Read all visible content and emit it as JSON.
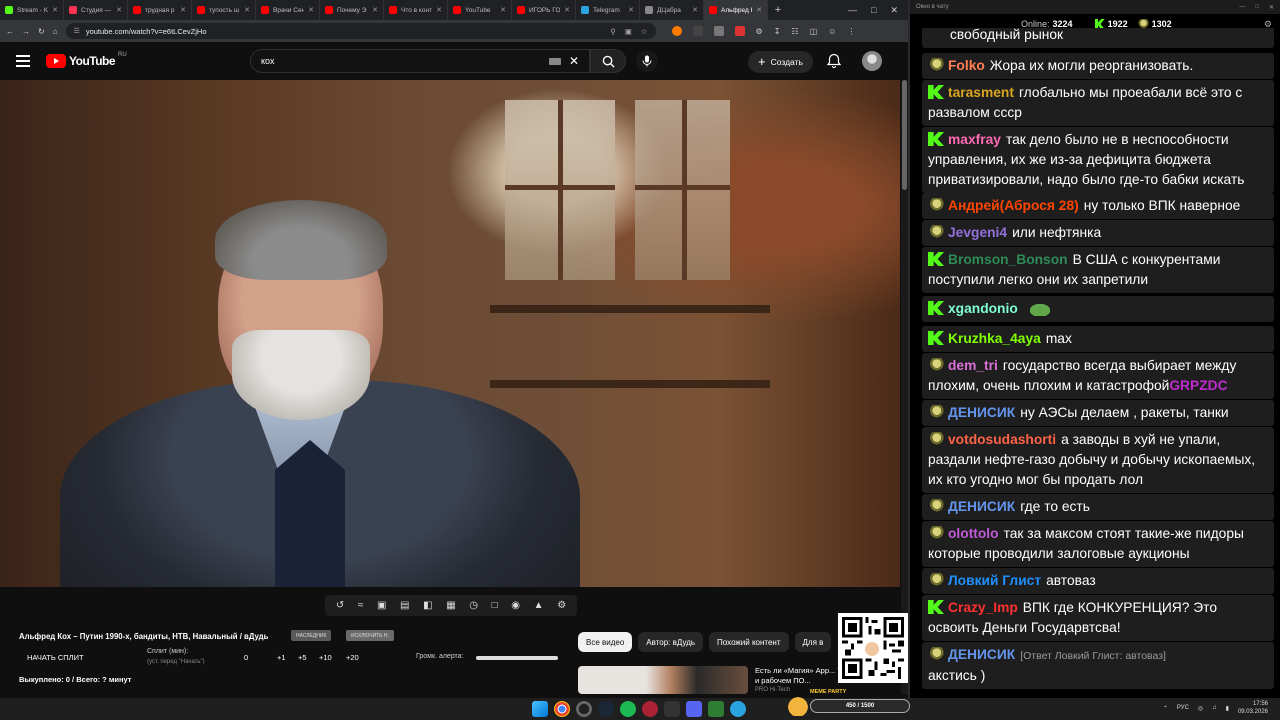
{
  "browser": {
    "tabs": [
      {
        "title": "Stream - K",
        "color": "#53fc18",
        "active": false
      },
      {
        "title": "Студия —",
        "color": "#ff3355",
        "active": false
      },
      {
        "title": "трудная р",
        "color": "#ff0000",
        "active": false
      },
      {
        "title": "тупость ш",
        "color": "#ff0000",
        "active": false
      },
      {
        "title": "Врачи Сен",
        "color": "#ff0000",
        "active": false
      },
      {
        "title": "Почему Э",
        "color": "#ff0000",
        "active": false
      },
      {
        "title": "Что в конт",
        "color": "#ff0000",
        "active": false
      },
      {
        "title": "YouTube",
        "color": "#ff0000",
        "active": false
      },
      {
        "title": "ИГОРЬ ГО",
        "color": "#ff0000",
        "active": false
      },
      {
        "title": "Telegram",
        "color": "#2aa3df",
        "active": false
      },
      {
        "title": "ДЦабра",
        "color": "#888888",
        "active": false
      },
      {
        "title": "Альфред К",
        "color": "#ff0000",
        "active": true
      }
    ],
    "url": "youtube.com/watch?v=e6tLCevZjHo"
  },
  "youtube": {
    "logo_text": "YouTube",
    "region": "RU",
    "search_value": "кох",
    "create_label": "Создать"
  },
  "video": {
    "title": "Альфред Кох – Путин 1990-х, бандиты, НТВ, Навальный / вДудь",
    "badge_1": "НАСЛЕДНИК",
    "badge_2": "ИСКЛЮЧИТЬ Н.",
    "split_start": "НАЧАТЬ СПЛИТ",
    "split_label": "Сплит (мин):",
    "split_hint": "(уст. перед \"Начать\")",
    "steps": [
      "0",
      "+1",
      "+5",
      "+10",
      "+20"
    ],
    "alert_label": "Громк. алерта:",
    "alert_volume": 1.0,
    "bought_line": "Выкуплено: 0 / Всего: ? минут"
  },
  "chips": [
    "Все видео",
    "Автор: вДудь",
    "Похожий контент",
    "Для в"
  ],
  "related": {
    "title": "Есть ли «Магия» App... Тест в играх и рабочем ПО...",
    "channel": "PRO Hi-Tech"
  },
  "chat": {
    "window_title": "Окно в чату",
    "online_label": "Online:",
    "online_count": "3224",
    "kick_count": "1922",
    "twitch_count": "1302",
    "top_partial": "свободный рынок",
    "messages": [
      {
        "badge": "bulb",
        "nick": "Folko",
        "color": "#ff7f50",
        "text": "Жора их могли реорганизовать."
      },
      {
        "badge": "kick",
        "nick": "tarasment",
        "color": "#daa520",
        "text": "глобально мы проеабали всё это с развалом ссср"
      },
      {
        "badge": "kick",
        "nick": "maxfray",
        "color": "#ff69b4",
        "text": "так дело было не в неспособности управления, их же из-за дефицита бюджета приватизировали, надо было где-то бабки искать"
      },
      {
        "badge": "bulb",
        "nick": "Андрей(Аброся 28)",
        "color": "#ff4500",
        "text": "ну только ВПК наверное"
      },
      {
        "badge": "bulb",
        "nick": "Jevgeni4",
        "color": "#9370db",
        "text": "или нефтянка"
      },
      {
        "badge": "kick",
        "nick": "Bromson_Bonson",
        "color": "#2e8b57",
        "text": "В США с конкурентами поступили легко они их запретили"
      },
      {
        "badge": "kick",
        "nick": "xgandonio",
        "color": "#7fffd4",
        "text": ""
      },
      {
        "badge": "kick",
        "nick": "Kruzhka_4aya",
        "color": "#7fff00",
        "text": "max"
      },
      {
        "badge": "bulb",
        "nick": "dem_tri",
        "color": "#da70d6",
        "text": "государство всегда выбирает между плохим, очень плохим и катастрофой",
        "emote_word": "GRPZDC"
      },
      {
        "badge": "bulb",
        "nick": "ДЕНИСИК",
        "color": "#6495ed",
        "text": "ну АЭСы делаем , ракеты, танки"
      },
      {
        "badge": "bulb",
        "nick": "votdosudashorti",
        "color": "#ff6347",
        "text": "а заводы в хуй не упали, раздали нефте-газо добычу и добычу ископаемых, их кто угодно мог бы продать лол"
      },
      {
        "badge": "bulb",
        "nick": "ДЕНИСИК",
        "color": "#6495ed",
        "text": "где то есть"
      },
      {
        "badge": "bulb",
        "nick": "olottolo",
        "color": "#c05ad7",
        "text": "так за максом стоят такие-же пидоры которые проводили залоговые аукционы"
      },
      {
        "badge": "bulb",
        "nick": "Ловкий Глист",
        "color": "#1e90ff",
        "text": "автоваз"
      },
      {
        "badge": "kick",
        "nick": "Crazy_Imp",
        "color": "#ff3030",
        "text": "ВПК где КОНКУРЕНЦИЯ? Это освоить Деньги Государвтсва!"
      },
      {
        "badge": "bulb",
        "nick": "ДЕНИСИК",
        "color": "#6495ed",
        "reply": "[Ответ Ловкий Глист: автоваз]",
        "text": "акстись )"
      }
    ]
  },
  "stream_widget": {
    "tag": "MEME PARTY",
    "progress": "450 / 1500"
  },
  "taskbar": {
    "lang": "РУС",
    "time": "17:56",
    "date": "09.03.2026"
  }
}
